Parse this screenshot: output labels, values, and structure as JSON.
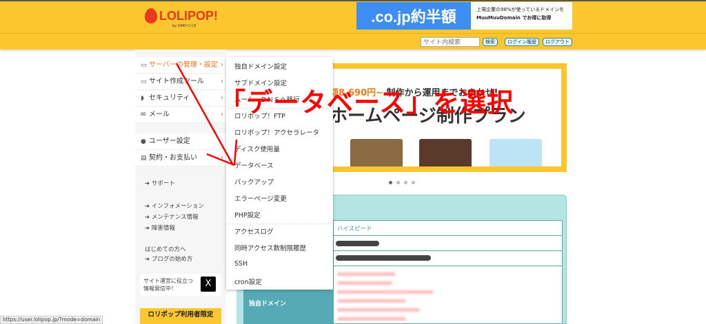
{
  "header": {
    "logo": "LOLIPOP!",
    "logo_sub": "by GMOペパボ",
    "ad_left": ".co.jp約半額",
    "ad_right_line1": "上場企業の98%が使っているドメインを",
    "ad_right_line2": "MuuMuuDomain でお得に取得",
    "search_placeholder": "サイト内検索",
    "search_btn": "検索",
    "login_history_btn": "ログイン履歴",
    "logout_btn": "ログアウト"
  },
  "sidebar": {
    "items": [
      {
        "label": "サーバーの管理・設定",
        "icon": "server-icon"
      },
      {
        "label": "サイト作成ツール",
        "icon": "laptop-icon"
      },
      {
        "label": "セキュリティ",
        "icon": "shield-icon"
      },
      {
        "label": "メール",
        "icon": "mail-icon"
      },
      {
        "label": "ユーザー設定",
        "icon": "user-icon"
      },
      {
        "label": "契約・お支払い",
        "icon": "card-icon"
      }
    ],
    "links": [
      "サポート",
      "インフォメーション",
      "メンテナンス情報",
      "障害情報"
    ],
    "beginner": "はじめての方へ",
    "blog": "ブログの始め方",
    "x_text_1": "サイト運営に役立つ",
    "x_text_2": "情報発信中！",
    "x_logo": "X",
    "user_only": "ロリポップ利用者限定"
  },
  "dropdown": [
    "独自ドメイン設定",
    "サブドメイン設定",
    "ムームーＤＮＳへ移行",
    "ロリポップ！FTP",
    "ロリポップ！アクセラレータ",
    "ディスク使用量",
    "データベース",
    "バックアップ",
    "エラーページ変更",
    "PHP設定",
    "アクセスログ",
    "同時アクセス数制限履歴",
    "SSH",
    "cron設定"
  ],
  "banner": {
    "price": "額8,690円~",
    "catch": "制作から運用までおまかせ!",
    "headline": "ホームページ制作プラン",
    "slide_count": 4,
    "active_slide": 1
  },
  "table": {
    "plan": "ハイスピード",
    "domain_label": "独自ドメイン"
  },
  "annotation": "「データベース」を選択",
  "status_url": "https://user.lolipop.jp/?mode=domain",
  "colors": {
    "brand": "#fcc62e",
    "accent": "#e8391d",
    "annotation": "#ff0000",
    "teal": "#55aab5"
  }
}
